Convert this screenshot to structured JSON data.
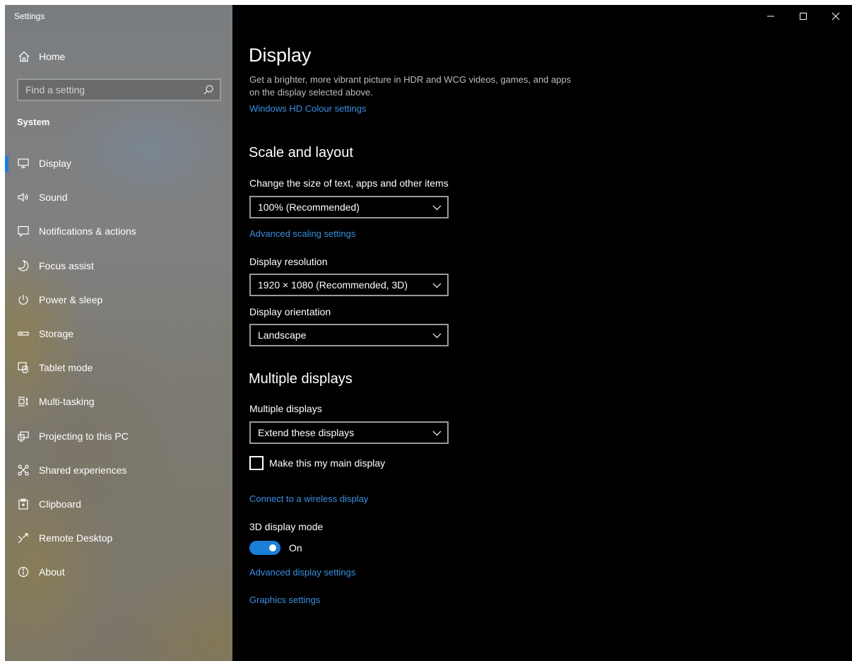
{
  "window": {
    "title": "Settings"
  },
  "sidebar": {
    "home_label": "Home",
    "search": {
      "placeholder": "Find a setting"
    },
    "section_title": "System",
    "items": [
      {
        "label": "Display",
        "icon": "monitor-icon",
        "active": true
      },
      {
        "label": "Sound",
        "icon": "speaker-icon"
      },
      {
        "label": "Notifications & actions",
        "icon": "notification-icon"
      },
      {
        "label": "Focus assist",
        "icon": "moon-icon"
      },
      {
        "label": "Power & sleep",
        "icon": "power-icon"
      },
      {
        "label": "Storage",
        "icon": "storage-icon"
      },
      {
        "label": "Tablet mode",
        "icon": "tablet-mode-icon"
      },
      {
        "label": "Multi-tasking",
        "icon": "multitasking-icon"
      },
      {
        "label": "Projecting to this PC",
        "icon": "projecting-icon"
      },
      {
        "label": "Shared experiences",
        "icon": "shared-experiences-icon"
      },
      {
        "label": "Clipboard",
        "icon": "clipboard-icon"
      },
      {
        "label": "Remote Desktop",
        "icon": "remote-desktop-icon"
      },
      {
        "label": "About",
        "icon": "info-icon"
      }
    ]
  },
  "main": {
    "title": "Display",
    "hdr_description": "Get a brighter, more vibrant picture in HDR and WCG videos, games, and apps on the display selected above.",
    "hdr_link": "Windows HD Colour settings",
    "scale_section": {
      "heading": "Scale and layout",
      "scale_label": "Change the size of text, apps and other items",
      "scale_value": "100% (Recommended)",
      "advanced_scaling_link": "Advanced scaling settings",
      "resolution_label": "Display resolution",
      "resolution_value": "1920 × 1080 (Recommended, 3D)",
      "orientation_label": "Display orientation",
      "orientation_value": "Landscape"
    },
    "multiple_section": {
      "heading": "Multiple displays",
      "multiple_label": "Multiple displays",
      "multiple_value": "Extend these displays",
      "main_display_checkbox": "Make this my main display",
      "wireless_link": "Connect to a wireless display",
      "mode_3d_label": "3D display mode",
      "mode_3d_state": "On",
      "advanced_display_link": "Advanced display settings",
      "graphics_link": "Graphics settings"
    }
  },
  "colors": {
    "accent": "#1a7fd6",
    "link": "#3b8fe0",
    "content_bg": "#000000"
  }
}
